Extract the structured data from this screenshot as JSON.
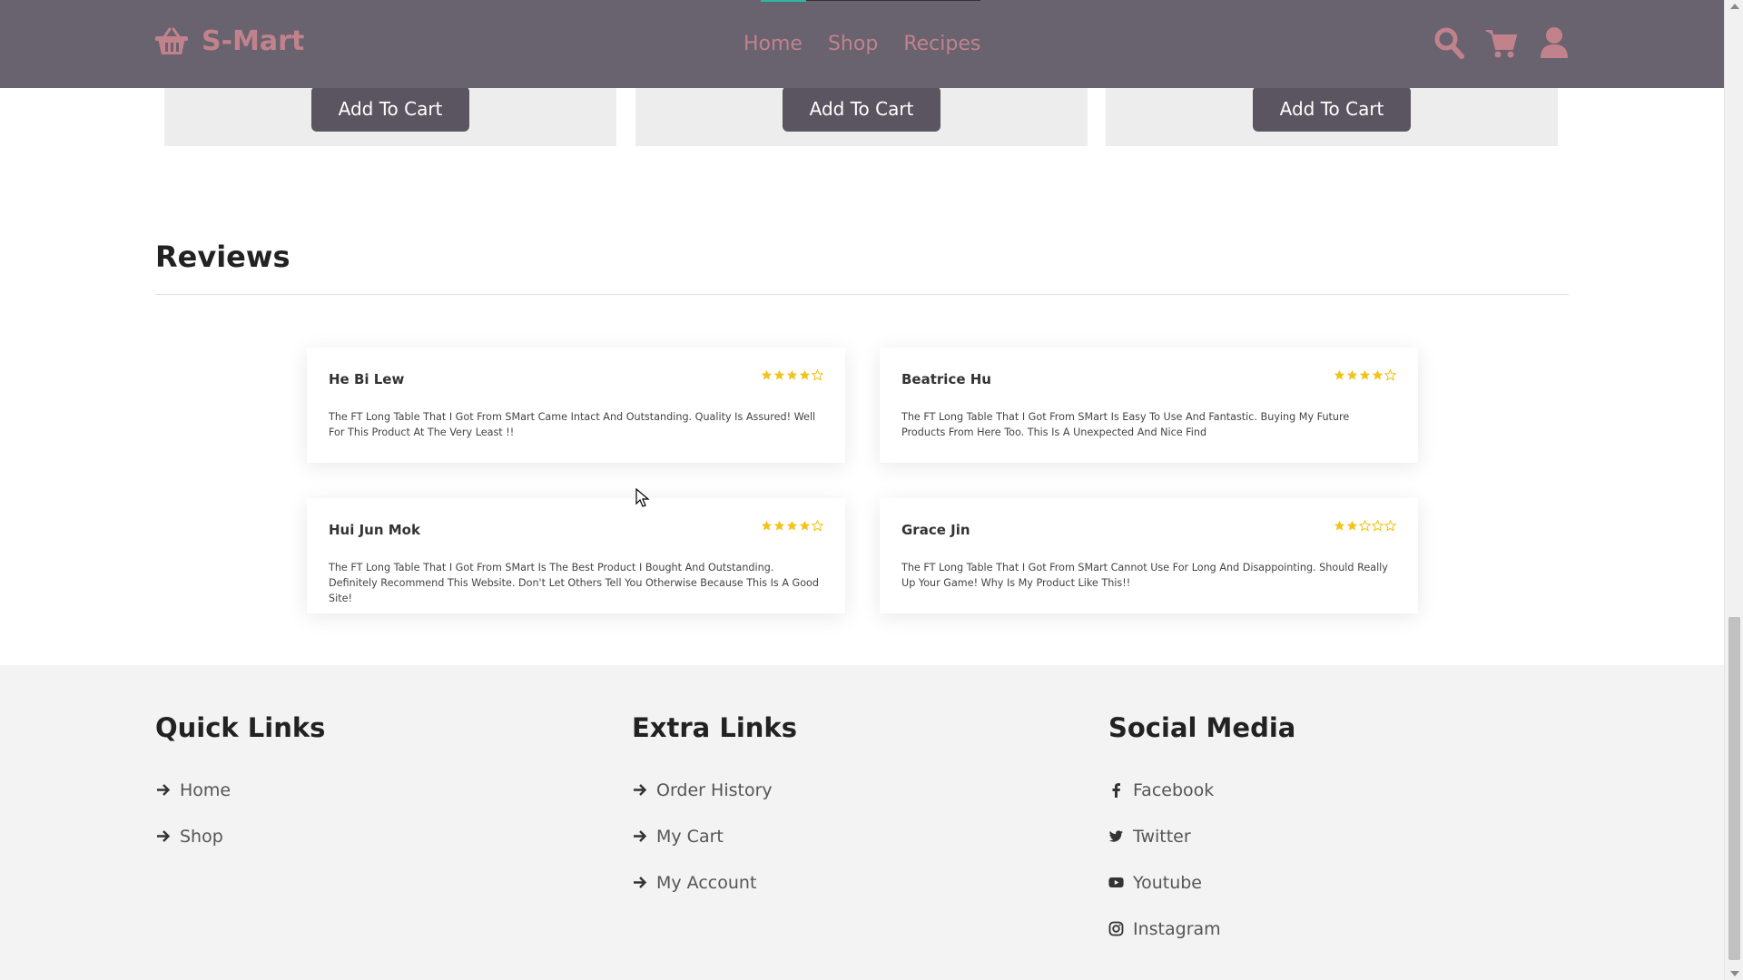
{
  "header": {
    "logo_text": "S-Mart",
    "nav": [
      "Home",
      "Shop",
      "Recipes"
    ],
    "icons": [
      "search-icon",
      "cart-icon",
      "user-icon"
    ]
  },
  "products": {
    "add_to_cart_label": "Add To Cart"
  },
  "reviews": {
    "title": "Reviews",
    "items": [
      {
        "name": "He Bi Lew",
        "rating": 4,
        "text": "The FT Long Table That I Got From SMart Came Intact And Outstanding. Quality Is Assured! Well For This Product At The Very Least !!"
      },
      {
        "name": "Beatrice Hu",
        "rating": 4,
        "text": "The FT Long Table That I Got From SMart Is Easy To Use And Fantastic. Buying My Future Products From Here Too. This Is A Unexpected And Nice Find"
      },
      {
        "name": "Hui Jun Mok",
        "rating": 4,
        "text": "The FT Long Table That I Got From SMart Is The Best Product I Bought And Outstanding. Definitely Recommend This Website. Don't Let Others Tell You Otherwise Because This Is A Good Site!"
      },
      {
        "name": "Grace Jin",
        "rating": 2,
        "text": "The FT Long Table That I Got From SMart Cannot Use For Long And Disappointing. Should Really Up Your Game! Why Is My Product Like This!!"
      }
    ]
  },
  "footer": {
    "quick_links": {
      "title": "Quick Links",
      "items": [
        "Home",
        "Shop"
      ]
    },
    "extra_links": {
      "title": "Extra Links",
      "items": [
        "Order History",
        "My Cart",
        "My Account"
      ]
    },
    "social_media": {
      "title": "Social Media",
      "items": [
        "Facebook",
        "Twitter",
        "Youtube",
        "Instagram"
      ]
    }
  },
  "colors": {
    "header_bg": "#68636f",
    "brand_pink": "#c1828c",
    "button_bg": "#5a5560",
    "star": "#f2c318",
    "footer_bg": "#f3f3f3"
  }
}
